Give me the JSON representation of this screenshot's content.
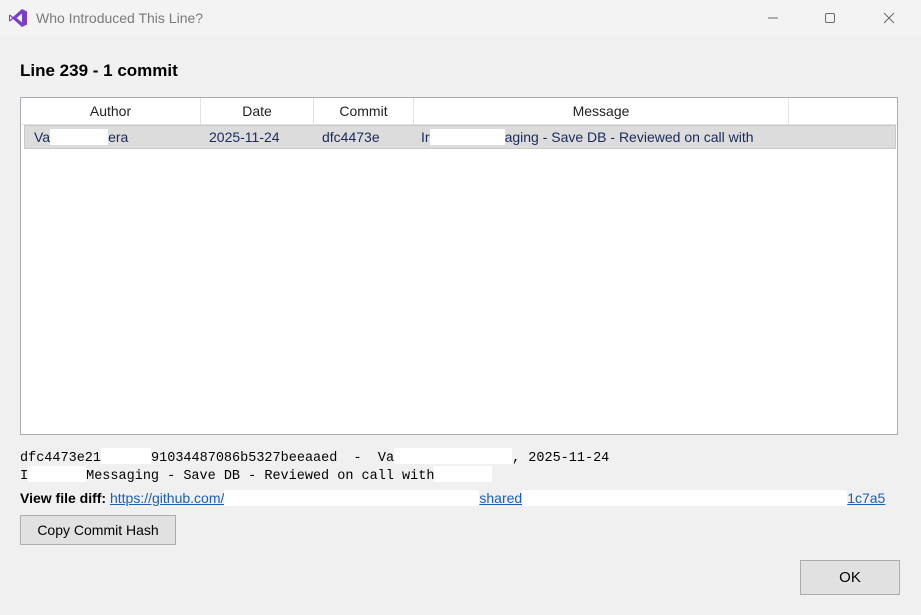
{
  "window": {
    "title": "Who Introduced This Line?",
    "icon": "visual-studio-icon"
  },
  "heading": "Line 239 - 1 commit",
  "table": {
    "columns": [
      "Author",
      "Date",
      "Commit",
      "Message"
    ],
    "rows": [
      {
        "author_start": "Va",
        "author_end": "era",
        "date": "2025-11-24",
        "commit": "dfc4473e",
        "message_start": "Ir",
        "message_end": "aging - Save DB - Reviewed on call with"
      }
    ]
  },
  "details": {
    "line1_a": "dfc4473e21",
    "line1_b": "91034487086b5327beeaaed  -  Va",
    "line1_c": ", 2025-11-24",
    "line2_a": "I",
    "line2_b": "Messaging - Save DB - Reviewed on call with"
  },
  "diff": {
    "label": "View file diff:",
    "link_start": "https://github.com/",
    "link_mid": "shared",
    "link_end": "1c7a5"
  },
  "buttons": {
    "copy_hash": "Copy Commit Hash",
    "ok": "OK"
  }
}
